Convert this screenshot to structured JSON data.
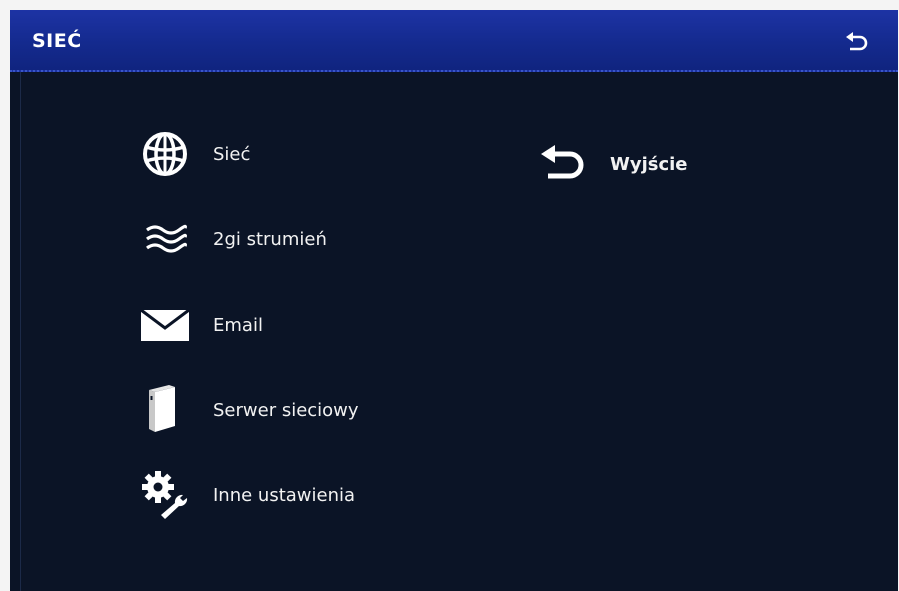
{
  "window": {
    "title": "SIEĆ",
    "back_icon": "back-arrow-icon"
  },
  "menu": {
    "items": [
      {
        "label": "Sieć",
        "icon": "globe-icon"
      },
      {
        "label": "2gi strumień",
        "icon": "waves-icon"
      },
      {
        "label": "Email",
        "icon": "envelope-icon"
      },
      {
        "label": "Serwer sieciowy",
        "icon": "server-icon"
      },
      {
        "label": "Inne ustawienia",
        "icon": "gear-wrench-icon"
      }
    ],
    "exit": {
      "label": "Wyjście",
      "icon": "back-arrow-icon"
    }
  },
  "colors": {
    "titlebar": "#142a8e",
    "background": "#0b1426",
    "text": "#ffffff"
  }
}
